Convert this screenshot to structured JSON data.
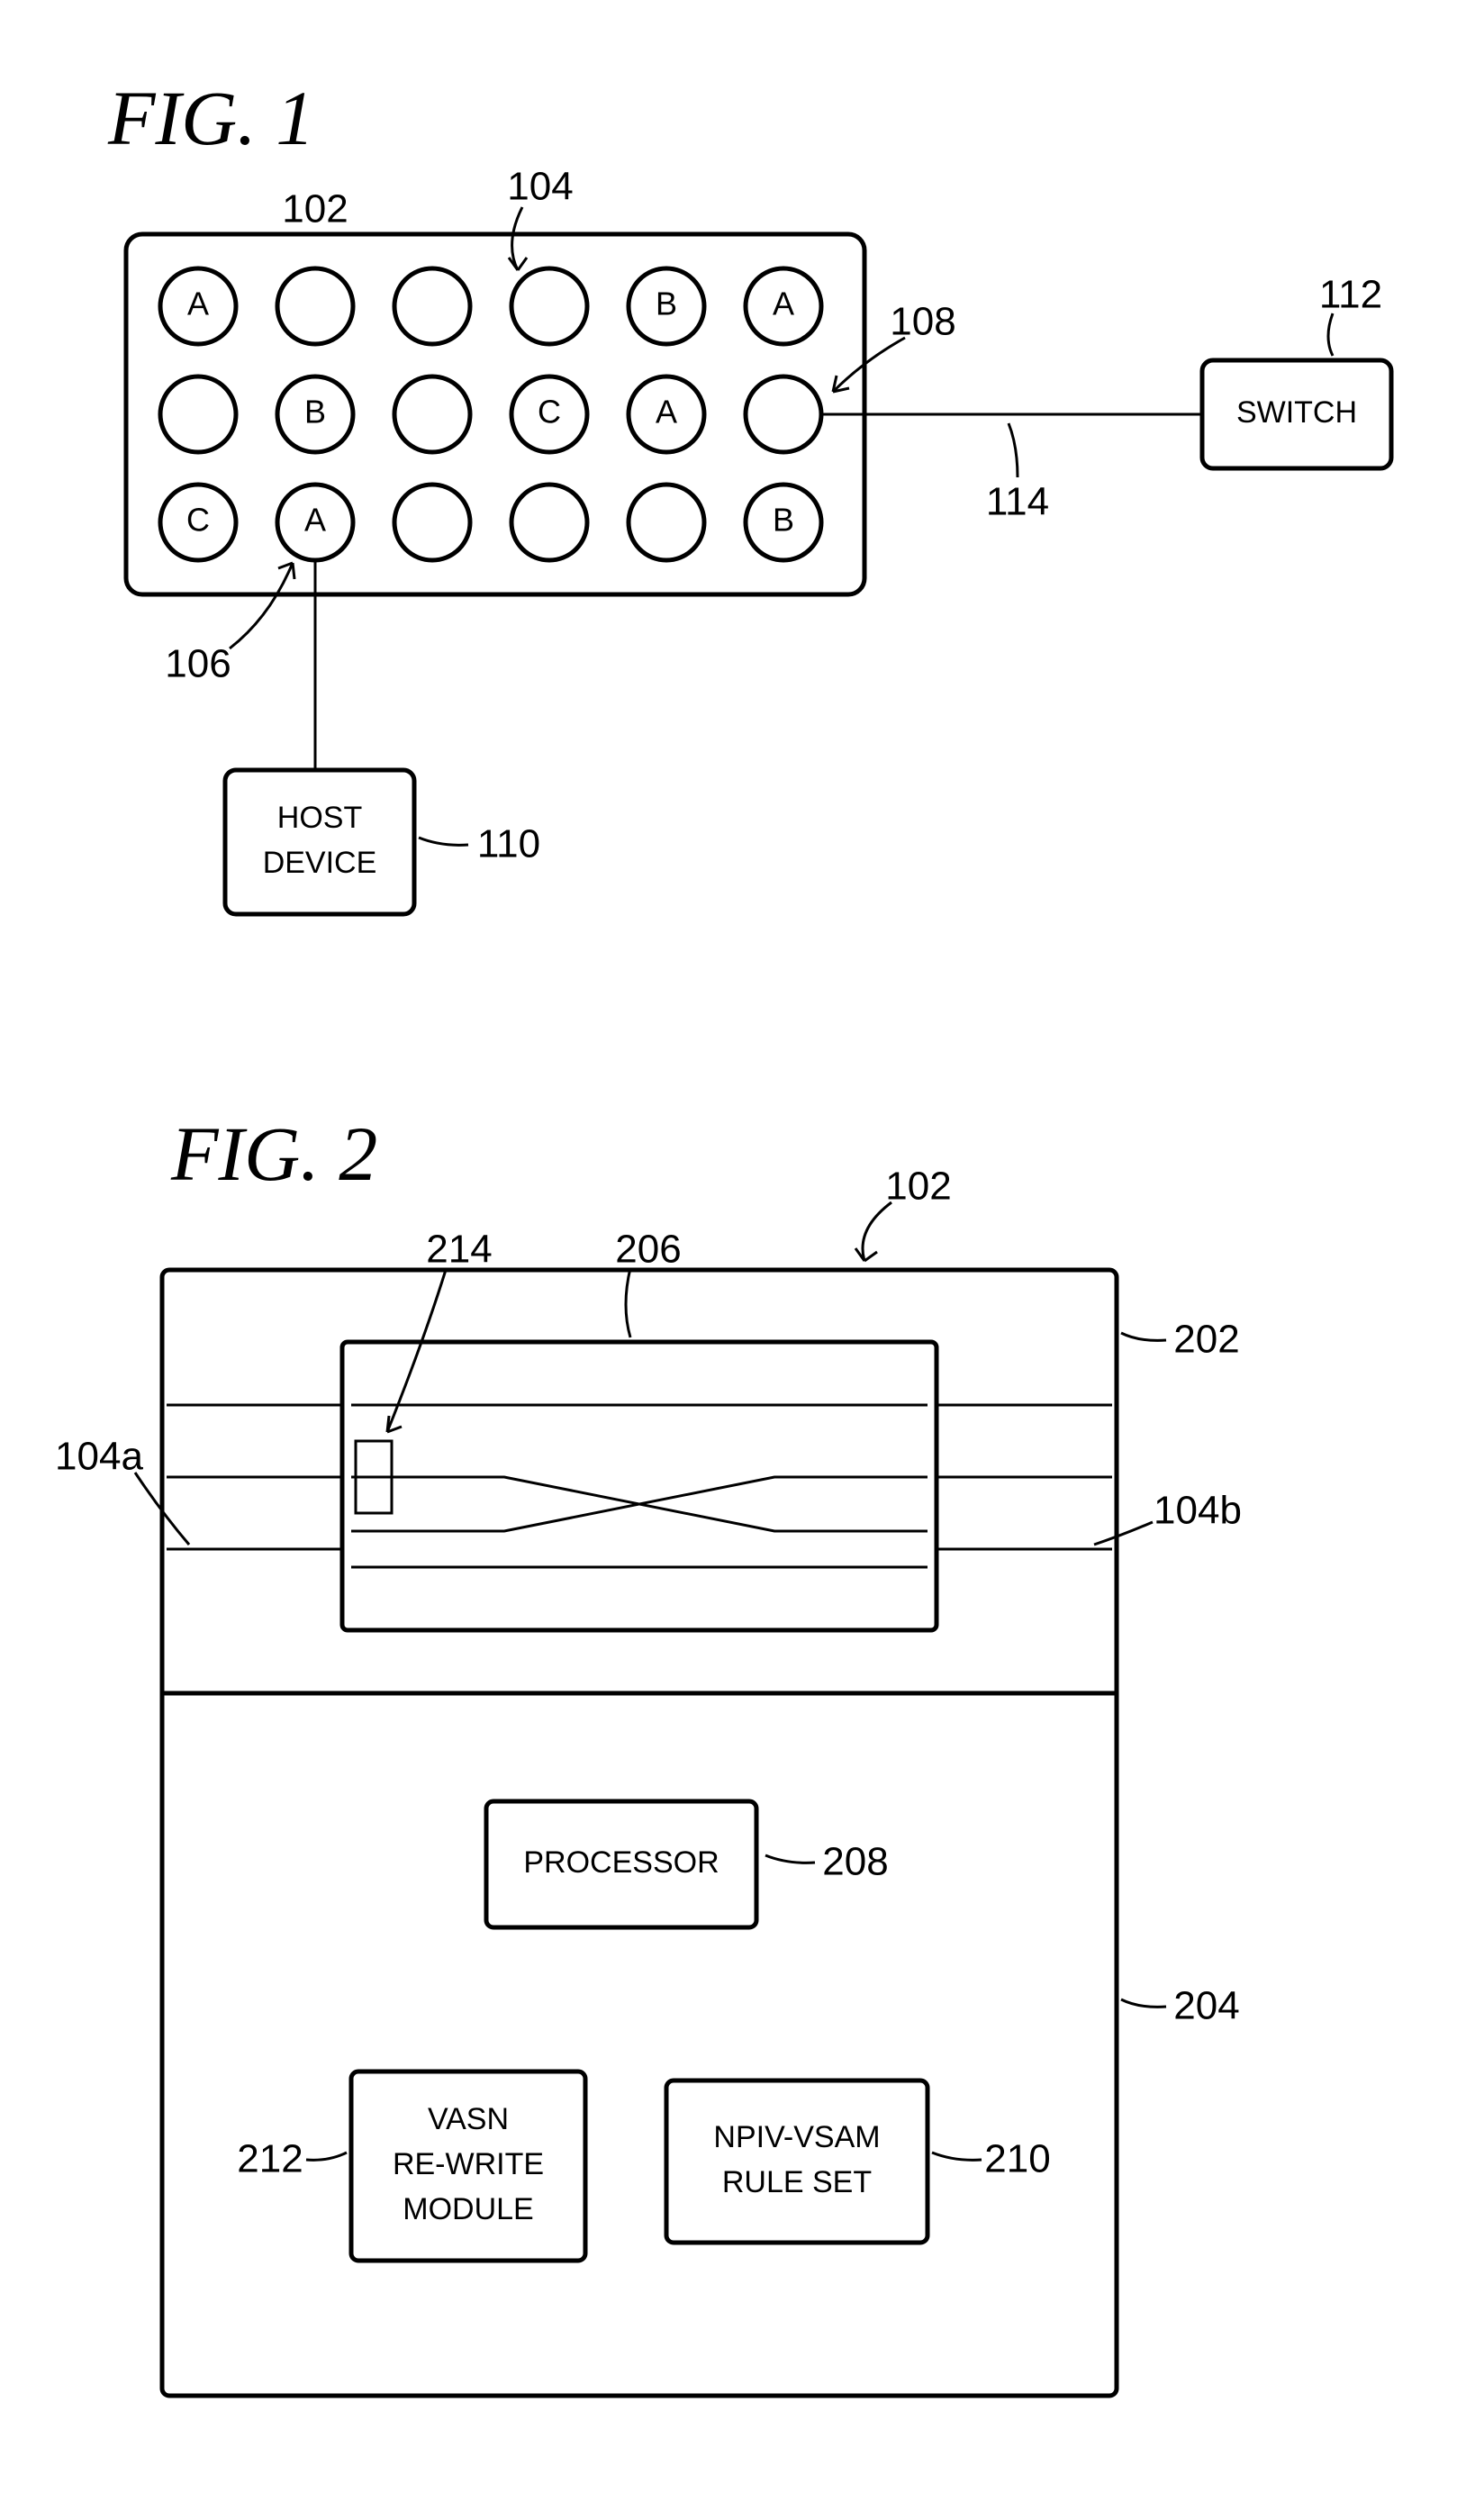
{
  "fig1": {
    "title": "FIG. 1",
    "refs": {
      "r102": "102",
      "r104": "104",
      "r106": "106",
      "r108": "108",
      "r110": "110",
      "r112": "112",
      "r114": "114"
    },
    "host": {
      "l1": "HOST",
      "l2": "DEVICE"
    },
    "switch": "SWITCH",
    "ports": [
      [
        "A",
        "",
        "",
        "",
        "B",
        "A"
      ],
      [
        "",
        "B",
        "",
        "C",
        "A",
        ""
      ],
      [
        "C",
        "A",
        "",
        "",
        "",
        "B"
      ]
    ]
  },
  "fig2": {
    "title": "FIG. 2",
    "refs": {
      "r102": "102",
      "r104a": "104a",
      "r104b": "104b",
      "r202": "202",
      "r204": "204",
      "r206": "206",
      "r208": "208",
      "r210": "210",
      "r212": "212",
      "r214": "214"
    },
    "processor": "PROCESSOR",
    "vasn": {
      "l1": "VASN",
      "l2": "RE-WRITE",
      "l3": "MODULE"
    },
    "npiv": {
      "l1": "NPIV-VSAM",
      "l2": "RULE SET"
    }
  }
}
